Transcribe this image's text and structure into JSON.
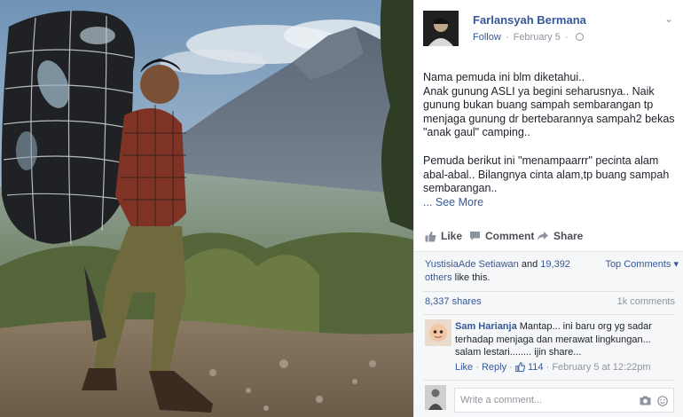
{
  "photo": {
    "description_icon": "hiker-photo"
  },
  "post": {
    "author": "Farlansyah Bermana",
    "follow_label": "Follow",
    "date": "February 5",
    "privacy_icon": "globe-icon",
    "text_lines_1": [
      "Nama pemuda ini blm diketahui..",
      "Anak gunung ASLI ya begini seharusnya.. Naik",
      "gunung bukan buang sampah sembarangan tp",
      "menjaga gunung dr bertebarannya sampah2 bekas",
      "\"anak gaul\" camping.."
    ],
    "text_lines_2": [
      "Pemuda berikut ini \"menampaarrr\" pecinta alam",
      "abal-abal.. Bilangnya cinta alam,tp buang sampah",
      "sembarangan.."
    ],
    "see_more": "... See More"
  },
  "actions": {
    "like": "Like",
    "comment": "Comment",
    "share": "Share"
  },
  "likes": {
    "names": "YustisiaAde Setiawan",
    "and": " and",
    "others": "19,392 others",
    "suffix": " like this.",
    "top_comments": "Top Comments ▾"
  },
  "counts": {
    "shares": "8,337 shares",
    "comments": "1k comments"
  },
  "comment": {
    "author": "Sam Harianja",
    "text": "Mantap... ini baru org yg sadar terhadap menjaga dan merawat lingkungan... salam lestari........ ijin share...",
    "like": "Like",
    "reply": "Reply",
    "like_count": "114",
    "timestamp": "February 5 at 12:22pm"
  },
  "reply_box": {
    "placeholder": "Write a comment..."
  },
  "colors": {
    "link": "#365899",
    "muted": "#90949c",
    "panel_bg": "#f6f7f9"
  }
}
